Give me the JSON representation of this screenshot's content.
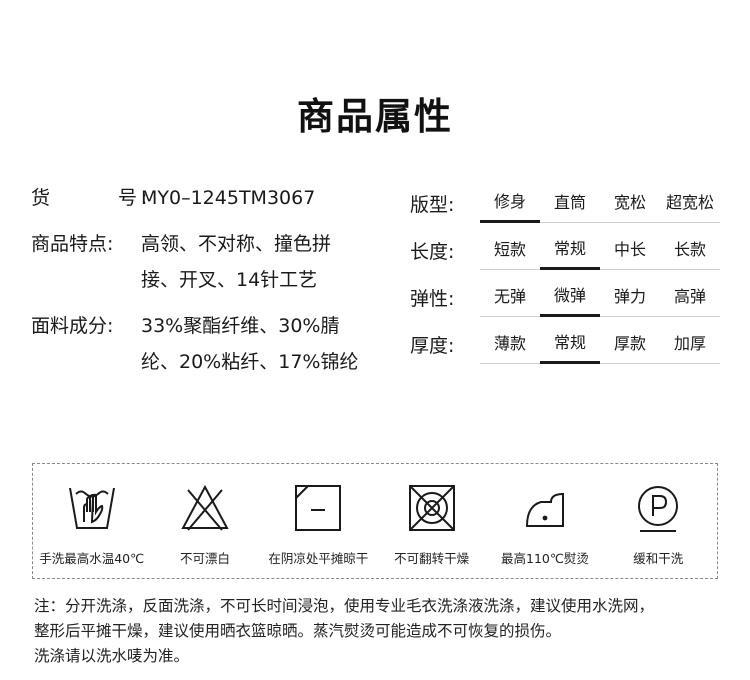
{
  "title": "商品属性",
  "info": {
    "sku": {
      "label_chars": [
        "货",
        "号"
      ],
      "colon": ":",
      "value": "MY0–1245TM3067"
    },
    "features": {
      "label": "商品特点:",
      "value": "高领、不对称、撞色拼接、开叉、14针工艺"
    },
    "material": {
      "label": "面料成分:",
      "value": "33%聚酯纤维、30%腈纶、20%粘纤、17%锦纶"
    }
  },
  "attributes": [
    {
      "label": "版型:",
      "options": [
        "修身",
        "直筒",
        "宽松",
        "超宽松"
      ],
      "selected": 0
    },
    {
      "label": "长度:",
      "options": [
        "短款",
        "常规",
        "中长",
        "长款"
      ],
      "selected": 1
    },
    {
      "label": "弹性:",
      "options": [
        "无弹",
        "微弹",
        "弹力",
        "高弹"
      ],
      "selected": 1
    },
    {
      "label": "厚度:",
      "options": [
        "薄款",
        "常规",
        "厚款",
        "加厚"
      ],
      "selected": 1
    }
  ],
  "care": [
    {
      "icon": "hand-wash-icon",
      "text": "手洗最高水温40℃"
    },
    {
      "icon": "no-bleach-icon",
      "text": "不可漂白"
    },
    {
      "icon": "shade-flat-dry-icon",
      "text": "在阴凉处平摊晾干"
    },
    {
      "icon": "no-tumble-dry-icon",
      "text": "不可翻转干燥"
    },
    {
      "icon": "iron-110-icon",
      "text": "最高110℃熨烫"
    },
    {
      "icon": "dry-clean-p-icon",
      "text": "缓和干洗"
    }
  ],
  "note": {
    "line1": "注：分开洗涤，反面洗涤，不可长时间浸泡，使用专业毛衣洗涤液洗涤，建议使用水洗网，",
    "line2": "整形后平摊干燥，建议使用晒衣篮晾晒。蒸汽熨烫可能造成不可恢复的损伤。",
    "line3": "洗涤请以洗水唛为准。"
  },
  "colors": {
    "text": "#1a1a1a",
    "divider": "#cfcfcf",
    "border": "#8a8a8a"
  }
}
